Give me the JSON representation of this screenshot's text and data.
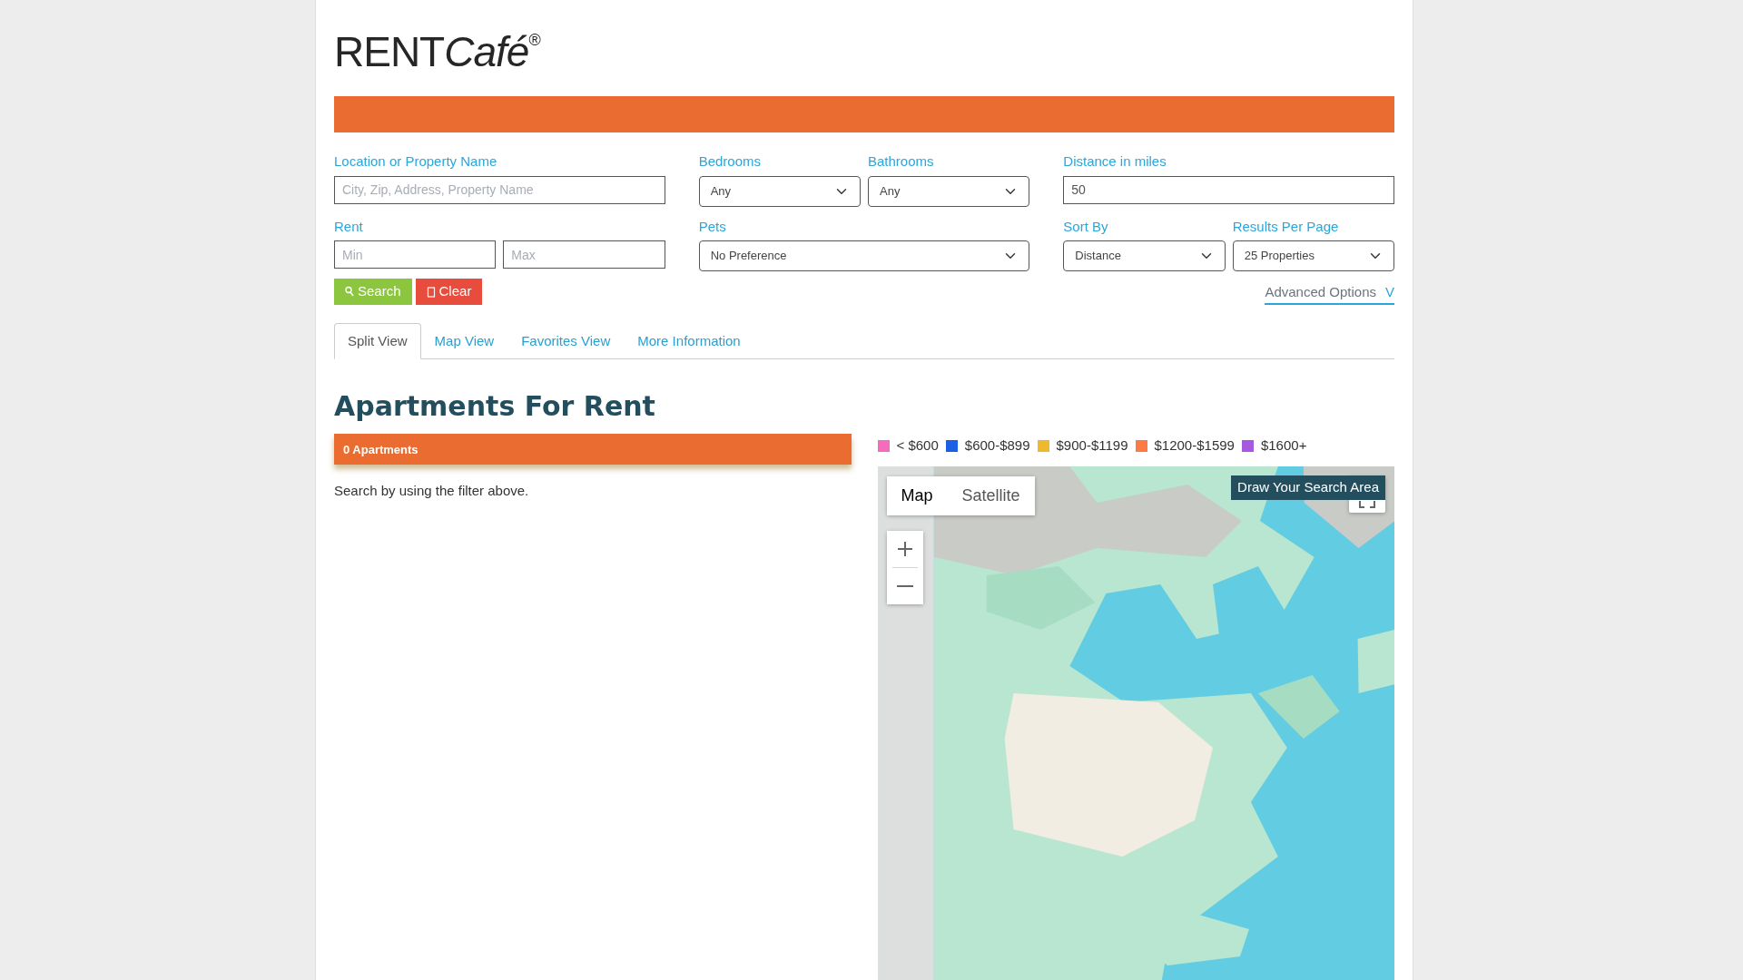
{
  "logo": {
    "plain": "RENT",
    "script": "Café",
    "registered": "®"
  },
  "filters": [
    {
      "label": "Location or Property Name",
      "kind": "text",
      "placeholder": "City, Zip, Address, Property Name"
    },
    {
      "label": "Bedrooms",
      "kind": "select",
      "value": "Any"
    },
    {
      "label": "Bathrooms",
      "kind": "select",
      "value": "Any"
    },
    {
      "label": "Distance in miles",
      "kind": "text",
      "value": "50"
    },
    {
      "label": "Rent",
      "kind": "range",
      "inputs": [
        {
          "placeholder": "Min"
        },
        {
          "placeholder": "Max"
        }
      ]
    },
    {
      "label": "Pets",
      "kind": "select",
      "value": "No Preference"
    },
    {
      "label": "Sort By",
      "kind": "select",
      "value": "Distance"
    },
    {
      "label": "Results Per Page",
      "kind": "select",
      "value": "25 Properties"
    }
  ],
  "buttons": [
    {
      "label": "Search",
      "kind": "search"
    },
    {
      "label": "Clear",
      "kind": "clear"
    }
  ],
  "advanced_options": {
    "label": "Advanced Options",
    "toggle": "V"
  },
  "tabs": [
    {
      "label": "Split View",
      "selected": true
    },
    {
      "label": "Map View",
      "selected": false
    },
    {
      "label": "Favorites View",
      "selected": false
    },
    {
      "label": "More Information",
      "selected": false
    }
  ],
  "heading": "Apartments For Rent",
  "results_bar": "0 Apartments",
  "message": "Search by using the filter above.",
  "legend": [
    {
      "label": "< $600",
      "color": "#f36cbd"
    },
    {
      "label": "$600-$899",
      "color": "#1a5fe6"
    },
    {
      "label": "$900-$1199",
      "color": "#efb92e"
    },
    {
      "label": "$1200-$1599",
      "color": "#fd7a45"
    },
    {
      "label": "$1600+",
      "color": "#a659e0"
    }
  ],
  "map": {
    "types": [
      {
        "label": "Map",
        "selected": true
      },
      {
        "label": "Satellite",
        "selected": false
      }
    ],
    "draw_tooltip": "Draw Your Search Area"
  }
}
